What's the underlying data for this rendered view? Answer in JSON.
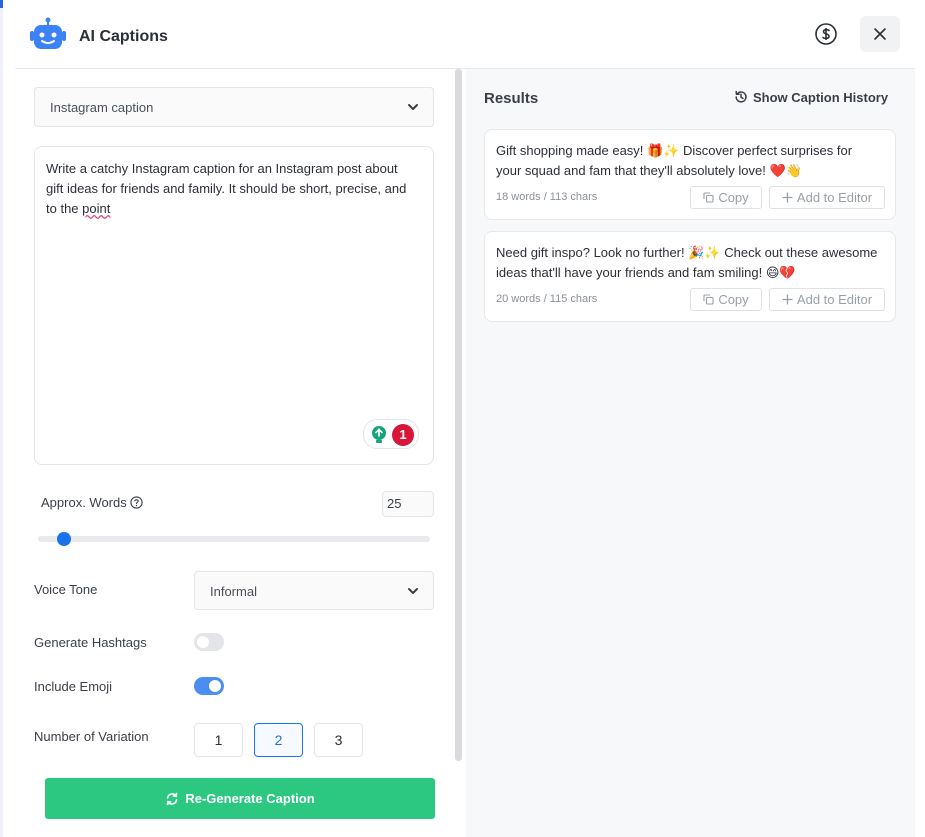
{
  "header": {
    "title": "AI Captions",
    "robot_icon": "robot-icon",
    "credit_icon": "dollar-circle-icon",
    "close_icon": "close-icon"
  },
  "colors": {
    "brand_blue": "#1a73e8",
    "robot_blue": "#3b82f6",
    "primary_green": "#2cc882",
    "toggle_on": "#4b8df0",
    "grammar_red": "#d9153a",
    "grammar_green": "#15a47a"
  },
  "form": {
    "caption_type": "Instagram caption",
    "prompt_lines": [
      "Write a catchy Instagram caption for an Instagram post about",
      "gift ideas for friends and family. It should be short, precise, and",
      "to the"
    ],
    "prompt_underlined_word": "point",
    "grammar_count": "1",
    "approx_words_label": "Approx. Words",
    "approx_words_value": "25",
    "approx_words_fraction": 0.05,
    "voice_tone_label": "Voice Tone",
    "voice_tone_value": "Informal",
    "hashtags_label": "Generate Hashtags",
    "hashtags_enabled": false,
    "emoji_label": "Include Emoji",
    "emoji_enabled": true,
    "variation_label": "Number of Variation",
    "variations": [
      "1",
      "2",
      "3"
    ],
    "selected_variation": "2",
    "regenerate_label": "Re-Generate Caption"
  },
  "results": {
    "title": "Results",
    "history_label": "Show Caption History",
    "copy_label": "Copy",
    "add_label": "Add to Editor",
    "items": [
      {
        "line1": "Gift shopping made easy! 🎁✨ Discover perfect surprises for",
        "line2": "your squad and fam that they'll absolutely love! ❤️👋",
        "meta": "18 words / 113 chars"
      },
      {
        "line1": "Need gift inspo? Look no further! 🎉✨ Check out these awesome",
        "line2": "ideas that'll have your friends and fam smiling! 😄💔",
        "meta": "20 words / 115 chars"
      }
    ]
  }
}
